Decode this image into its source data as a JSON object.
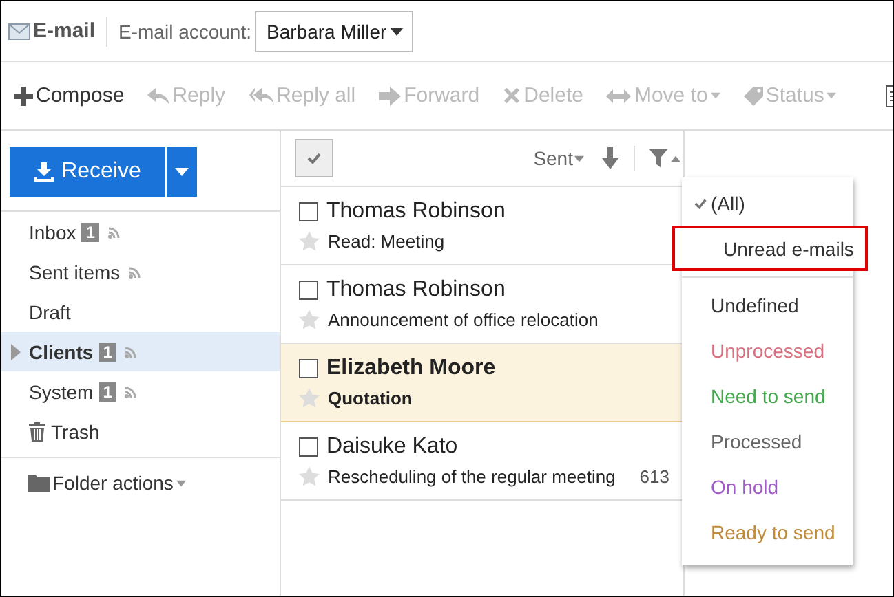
{
  "header": {
    "title": "E-mail",
    "account_label": "E-mail account:",
    "account": "Barbara Miller"
  },
  "toolbar": [
    {
      "kind": "compose",
      "label": "Compose",
      "disabled": false,
      "dropdown": false
    },
    {
      "kind": "reply",
      "label": "Reply",
      "disabled": true,
      "dropdown": false
    },
    {
      "kind": "reply-all",
      "label": "Reply all",
      "disabled": true,
      "dropdown": false
    },
    {
      "kind": "forward",
      "label": "Forward",
      "disabled": true,
      "dropdown": false
    },
    {
      "kind": "delete",
      "label": "Delete",
      "disabled": true,
      "dropdown": false
    },
    {
      "kind": "move",
      "label": "Move to",
      "disabled": true,
      "dropdown": true
    },
    {
      "kind": "status",
      "label": "Status",
      "disabled": true,
      "dropdown": true
    }
  ],
  "receive_button": "Receive",
  "folders": [
    {
      "kind": "folder",
      "label": "Inbox",
      "count": "1",
      "feed": true,
      "selected": false,
      "expandable": false
    },
    {
      "kind": "folder",
      "label": "Sent items",
      "feed": true,
      "selected": false,
      "expandable": false
    },
    {
      "kind": "folder",
      "label": "Draft",
      "feed": false,
      "selected": false,
      "expandable": false
    },
    {
      "kind": "folder",
      "label": "Clients",
      "count": "1",
      "feed": true,
      "selected": true,
      "expandable": true
    },
    {
      "kind": "folder",
      "label": "System",
      "count": "1",
      "feed": true,
      "selected": false,
      "expandable": false
    },
    {
      "kind": "trash",
      "label": "Trash",
      "feed": false,
      "selected": false,
      "expandable": false
    }
  ],
  "folder_actions": "Folder actions",
  "list_header": {
    "sort": "Sent"
  },
  "messages": [
    {
      "sender": "Thomas Robinson",
      "subject": "Read: Meeting",
      "unread": false,
      "selected": false,
      "checked": false,
      "starred": false
    },
    {
      "sender": "Thomas Robinson",
      "subject": "Announcement of office relocation",
      "unread": false,
      "selected": false,
      "checked": false,
      "starred": false
    },
    {
      "sender": "Elizabeth Moore",
      "subject": "Quotation",
      "unread": true,
      "selected": true,
      "checked": false,
      "starred": false
    },
    {
      "sender": "Daisuke Kato",
      "subject": "Rescheduling of the regular meeting",
      "size": "613",
      "unread": false,
      "selected": false,
      "checked": false,
      "starred": false
    }
  ],
  "filter_menu": {
    "options": [
      {
        "label": "(All)",
        "checked": true,
        "highlighted": false,
        "color": "#333333"
      },
      {
        "label": "Unread e-mails",
        "checked": false,
        "highlighted": true,
        "color": "#333333"
      }
    ],
    "statuses": [
      {
        "label": "Undefined",
        "color": "#333333"
      },
      {
        "label": "Unprocessed",
        "color": "#d9707f"
      },
      {
        "label": "Need to send",
        "color": "#3fa94a"
      },
      {
        "label": "Processed",
        "color": "#666666"
      },
      {
        "label": "On hold",
        "color": "#a05cc8"
      },
      {
        "label": "Ready to send",
        "color": "#c08a3a"
      }
    ]
  }
}
